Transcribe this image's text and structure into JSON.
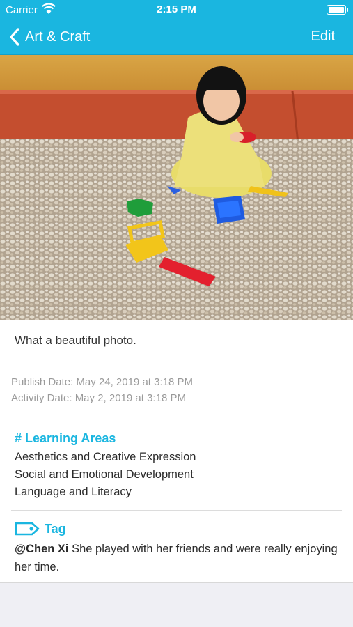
{
  "status_bar": {
    "carrier": "Carrier",
    "time": "2:15 PM"
  },
  "nav": {
    "back_label": "Art & Craft",
    "edit_label": "Edit"
  },
  "post": {
    "caption": "What a beautiful photo.",
    "publish_date": "Publish Date: May 24, 2019 at 3:18 PM",
    "activity_date": "Activity Date: May 2, 2019 at 3:18 PM"
  },
  "learning_areas": {
    "title": "# Learning Areas",
    "items": [
      "Aesthetics and Creative Expression",
      "Social and Emotional Development",
      "Language and Literacy"
    ]
  },
  "tag": {
    "title": "Tag",
    "mention": "@Chen Xi",
    "text": " She played with her friends and were really enjoying her time."
  },
  "colors": {
    "accent": "#1ab6e0",
    "background": "#efeff4"
  }
}
